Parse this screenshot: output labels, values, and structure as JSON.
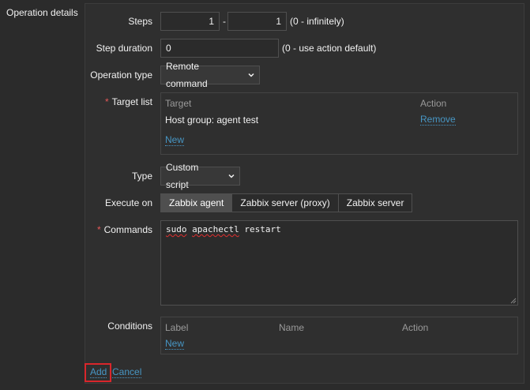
{
  "section_label": "Operation details",
  "steps": {
    "label": "Steps",
    "from": "1",
    "separator": "-",
    "to": "1",
    "hint": "(0 - infinitely)"
  },
  "step_duration": {
    "label": "Step duration",
    "value": "0",
    "hint": "(0 - use action default)"
  },
  "operation_type": {
    "label": "Operation type",
    "value": "Remote command"
  },
  "target_list": {
    "required_mark": "*",
    "label": "Target list",
    "columns": [
      "Target",
      "Action"
    ],
    "rows": [
      {
        "target": "Host group: agent test",
        "action": "Remove"
      }
    ],
    "new_link": "New"
  },
  "type": {
    "label": "Type",
    "value": "Custom script"
  },
  "execute_on": {
    "label": "Execute on",
    "options": [
      "Zabbix agent",
      "Zabbix server (proxy)",
      "Zabbix server"
    ],
    "selected": "Zabbix agent"
  },
  "commands": {
    "required_mark": "*",
    "label": "Commands",
    "word1": "sudo",
    "word2": "apachectl",
    "word3": "restart"
  },
  "conditions": {
    "label": "Conditions",
    "columns": [
      "Label",
      "Name",
      "Action"
    ],
    "new_link": "New"
  },
  "actions": {
    "add": "Add",
    "cancel": "Cancel"
  },
  "colors": {
    "background": "#2b2b2b",
    "link": "#4796c4",
    "required": "#e45959",
    "highlight": "#d9262b"
  }
}
